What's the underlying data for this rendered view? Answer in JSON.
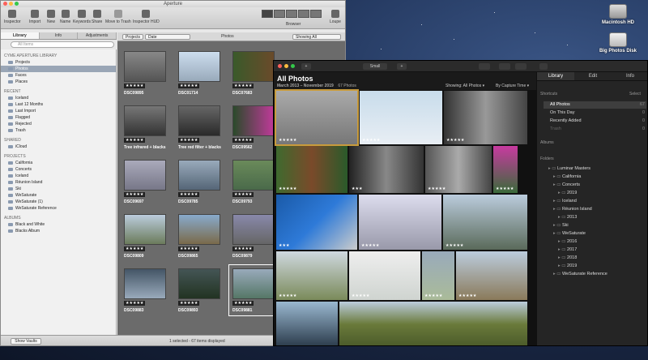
{
  "desktop": {
    "icons": [
      {
        "label": "Macintosh HD"
      },
      {
        "label": "Big Photos Disk"
      }
    ]
  },
  "aperture": {
    "title": "Aperture",
    "toolbar": [
      {
        "label": "Inspector"
      },
      {
        "label": "Import"
      },
      {
        "label": "New"
      },
      {
        "label": "Name"
      },
      {
        "label": "Keywords"
      },
      {
        "label": "Share"
      },
      {
        "label": "Move to Trash"
      },
      {
        "label": "Inspector HUD"
      }
    ],
    "browser_label": "Browser",
    "loupe_label": "Loupe",
    "tabs": [
      "Library",
      "Info",
      "Adjustments"
    ],
    "search_placeholder": "All Items",
    "sidebar": [
      {
        "section": "CYME APERTURE LIBRARY",
        "items": [
          "Projects",
          "Photos",
          "Faces",
          "Places"
        ]
      },
      {
        "section": "RECENT",
        "items": [
          "Iceland",
          "Last 12 Months",
          "Last Import",
          "Flagged",
          "Rejected",
          "Trash"
        ]
      },
      {
        "section": "SHARED",
        "items": [
          "iCloud"
        ]
      },
      {
        "section": "PROJECTS",
        "items": [
          "California",
          "Concerts",
          "Iceland",
          "Réunion Island",
          "Ski",
          "WeSaturate",
          "WeSaturate (1)",
          "WeSaturate Reference"
        ]
      },
      {
        "section": "ALBUMS",
        "items": [
          "Black and White",
          "Blacks Album"
        ]
      }
    ],
    "selected_sidebar": "Photos",
    "browser_bar": {
      "projects": "Projects",
      "sort": "Date",
      "photos": "Photos",
      "search": "Showing All"
    },
    "photos": [
      {
        "name": "DSC09895",
        "stars": "★★★★★"
      },
      {
        "name": "DSC01714",
        "stars": "★★★★★"
      },
      {
        "name": "DSC07683",
        "stars": "★★★★★"
      },
      {
        "name": "Tree infrared + blacks",
        "stars": "★★★★★"
      },
      {
        "name": "Tree red filter + blacks",
        "stars": "★★★★★"
      },
      {
        "name": "DSC09562",
        "stars": "★★★★★"
      },
      {
        "name": "DSC09697",
        "stars": "★★★★★"
      },
      {
        "name": "DSC09785",
        "stars": "★★★★★"
      },
      {
        "name": "DSC09793",
        "stars": "★★★★★"
      },
      {
        "name": "DSC09809",
        "stars": "★★★★★"
      },
      {
        "name": "DSC09865",
        "stars": "★★★★★"
      },
      {
        "name": "DSC09879",
        "stars": "★★★★★"
      },
      {
        "name": "DSC09883",
        "stars": "★★★★★"
      },
      {
        "name": "DSC09893",
        "stars": "★★★★★"
      },
      {
        "name": "DSC09881",
        "stars": "★★★★★"
      }
    ],
    "show_vaults": "Show Vaults",
    "status": "1 selected - 67 items displayed"
  },
  "luminar": {
    "toolbar": {
      "add": "+",
      "view": "Small",
      "plus2": "+"
    },
    "title": "All Photos",
    "subtitle": "March 2013 – November 2019",
    "count": "67 Photos",
    "showing": "Showing: All Photos ▾",
    "sort": "By Capture Time ▾",
    "tabs": [
      "Library",
      "Edit",
      "Info"
    ],
    "shortcuts_label": "Shortcuts",
    "select_label": "Select",
    "shortcuts": [
      {
        "label": "All Photos",
        "count": "67"
      },
      {
        "label": "On This Day",
        "count": "0"
      },
      {
        "label": "Recently Added",
        "count": "0"
      },
      {
        "label": "Trash",
        "count": "0"
      }
    ],
    "albums_label": "Albums",
    "folders_label": "Folders",
    "folders": [
      {
        "label": "Luminar Masters",
        "count": "",
        "indent": 0
      },
      {
        "label": "California",
        "count": "",
        "indent": 1
      },
      {
        "label": "Concerts",
        "count": "",
        "indent": 1
      },
      {
        "label": "2019",
        "count": "",
        "indent": 2
      },
      {
        "label": "Iceland",
        "count": "",
        "indent": 1
      },
      {
        "label": "Réunion Island",
        "count": "",
        "indent": 1
      },
      {
        "label": "2013",
        "count": "",
        "indent": 2
      },
      {
        "label": "Ski",
        "count": "",
        "indent": 1
      },
      {
        "label": "WeSaturate",
        "count": "",
        "indent": 1
      },
      {
        "label": "2016",
        "count": "",
        "indent": 2
      },
      {
        "label": "2017",
        "count": "",
        "indent": 2
      },
      {
        "label": "2018",
        "count": "",
        "indent": 2
      },
      {
        "label": "2019",
        "count": "",
        "indent": 2
      },
      {
        "label": "WeSaturate Reference",
        "count": "",
        "indent": 1
      }
    ],
    "photo_stars": [
      "★★★★★",
      "★★★★★",
      "★★★★★",
      "★★★★★",
      "★★★",
      "★★★★★",
      "★★★★★",
      "★★★",
      "★★★★★",
      "★★★★★",
      "★★★★★",
      "★★★★★",
      "★★★★★",
      "★★★★★"
    ]
  },
  "colors": {
    "selected": "#9aa6b6",
    "luminar_bg": "#1a1a1a",
    "accent_orange": "#c89b3c"
  }
}
